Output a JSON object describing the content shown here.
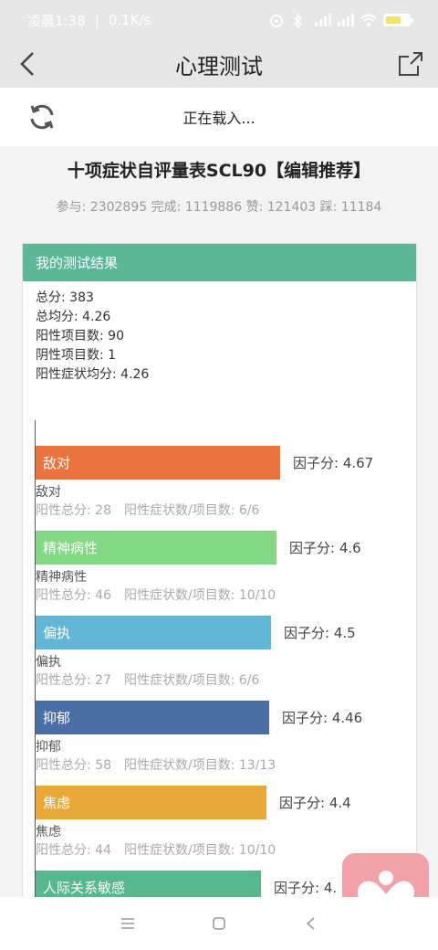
{
  "status_bar": {
    "time": "凌晨1:38",
    "separator": "|",
    "speed": "0.1K/s",
    "battery": "67"
  },
  "title_bar": {
    "title": "心理测试"
  },
  "loading": {
    "text": "正在载入..."
  },
  "test": {
    "title": "十项症状自评量表SCL90【编辑推荐】",
    "stats": "参与: 2302895 完成: 1119886 赞: 121403 踩: 11184"
  },
  "result": {
    "header": "我的测试结果",
    "summary": [
      "总分: 383",
      "总均分: 4.26",
      "阳性项目数: 90",
      "阴性项目数: 1",
      "阳性症状均分: 4.26"
    ]
  },
  "chart_data": {
    "type": "bar",
    "categories": [
      "敌对",
      "精神病性",
      "偏执",
      "抑郁",
      "焦虑",
      "人际关系敏感"
    ],
    "values": [
      4.67,
      4.6,
      4.5,
      4.46,
      4.4,
      4.3
    ],
    "colors": [
      "#ea733d",
      "#82d883",
      "#62b6d5",
      "#4a6ea6",
      "#e9a838",
      "#58b88d"
    ],
    "score_labels": [
      "因子分: 4.67",
      "因子分: 4.6",
      "因子分: 4.5",
      "因子分: 4.46",
      "因子分: 4.4",
      "因子分: 4."
    ],
    "details": [
      {
        "positive_total": "阳性总分: 28",
        "ratio": "阳性症状数/项目数: 6/6"
      },
      {
        "positive_total": "阳性总分: 46",
        "ratio": "阳性症状数/项目数: 10/10"
      },
      {
        "positive_total": "阳性总分: 27",
        "ratio": "阳性症状数/项目数: 6/6"
      },
      {
        "positive_total": "阳性总分: 58",
        "ratio": "阳性症状数/项目数: 13/13"
      },
      {
        "positive_total": "阳性总分: 44",
        "ratio": "阳性症状数/项目数: 10/10"
      }
    ]
  },
  "icons": {
    "back": "back-arrow-icon",
    "share": "share-icon",
    "refresh": "refresh-icon",
    "fab": "heart-person-icon",
    "nav_menu": "menu-icon",
    "nav_home": "home-icon",
    "nav_back": "back-icon"
  }
}
